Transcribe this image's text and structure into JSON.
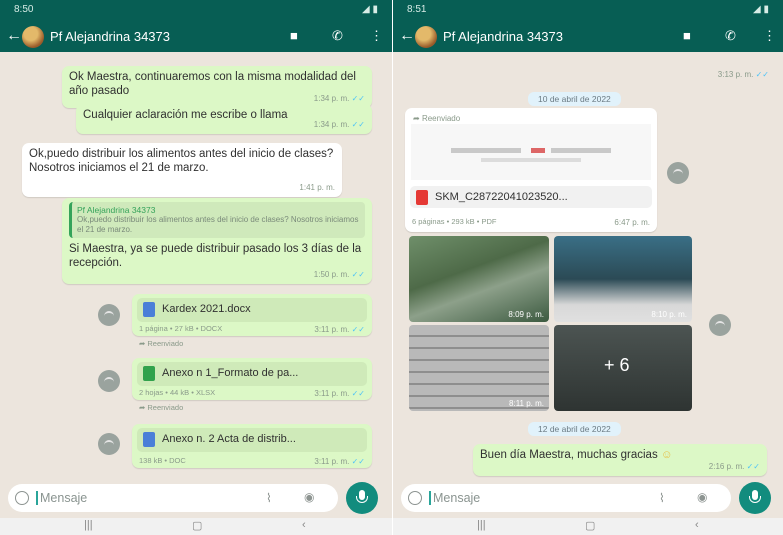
{
  "left": {
    "status": {
      "time": "8:50",
      "system": "◢ ▮"
    },
    "header": {
      "title": "Pf Alejandrina 34373"
    },
    "messages": [
      {
        "text": "Ok Maestra, continuaremos con la misma modalidad del año pasado",
        "time": "1:34 p. m."
      },
      {
        "text": "Cualquier aclaración me escribe o llama",
        "time": "1:34 p. m."
      },
      {
        "text": "Ok,puedo distribuir los alimentos antes del inicio de clases? Nosotros iniciamos el 21 de marzo.",
        "time": "1:41 p. m."
      },
      {
        "quote_name": "Pf Alejandrina 34373",
        "quote_text": "Ok,puedo distribuir los alimentos antes del inicio de clases? Nosotros iniciamos el 21 de marzo.",
        "text": "Si Maestra, ya se puede distribuir pasado los 3 días de la recepción.",
        "time": "1:50 p. m."
      }
    ],
    "docs": [
      {
        "name": "Kardex 2021.docx",
        "meta": "1 página • 27 kB • DOCX",
        "time": "3:11 p. m.",
        "forwarded": "Reenviado"
      },
      {
        "name": "Anexo n 1_Formato de pa...",
        "meta": "2 hojas • 44 kB • XLSX",
        "time": "3:11 p. m.",
        "forwarded": "Reenviado"
      },
      {
        "name": "Anexo n. 2 Acta de distrib...",
        "meta": "138 kB • DOC",
        "time": "3:11 p. m."
      }
    ],
    "input": {
      "placeholder": "Mensaje"
    }
  },
  "right": {
    "status": {
      "time": "8:51",
      "system": "◢ ▮"
    },
    "header": {
      "title": "Pf Alejandrina 34373"
    },
    "top_time": "3:13 p. m.",
    "date1": "10 de abril de 2022",
    "pdf": {
      "forwarded": "Reenviado",
      "name": "SKM_C28722041023520...",
      "meta": "6 páginas • 293 kB • PDF",
      "time": "6:47 p. m."
    },
    "photos": [
      {
        "time": "8:09 p. m."
      },
      {
        "time": "8:10 p. m."
      },
      {
        "time": "8:11 p. m."
      },
      {
        "more": "+ 6"
      }
    ],
    "date2": "12 de abril de 2022",
    "message": {
      "text": "Buen día Maestra, muchas gracias",
      "time": "2:16 p. m."
    },
    "input": {
      "placeholder": "Mensaje"
    }
  },
  "colors": {
    "header": "#075e54",
    "chat_bg": "#ece5dd",
    "outgoing": "#dcf8c6",
    "mic": "#128c7e"
  }
}
